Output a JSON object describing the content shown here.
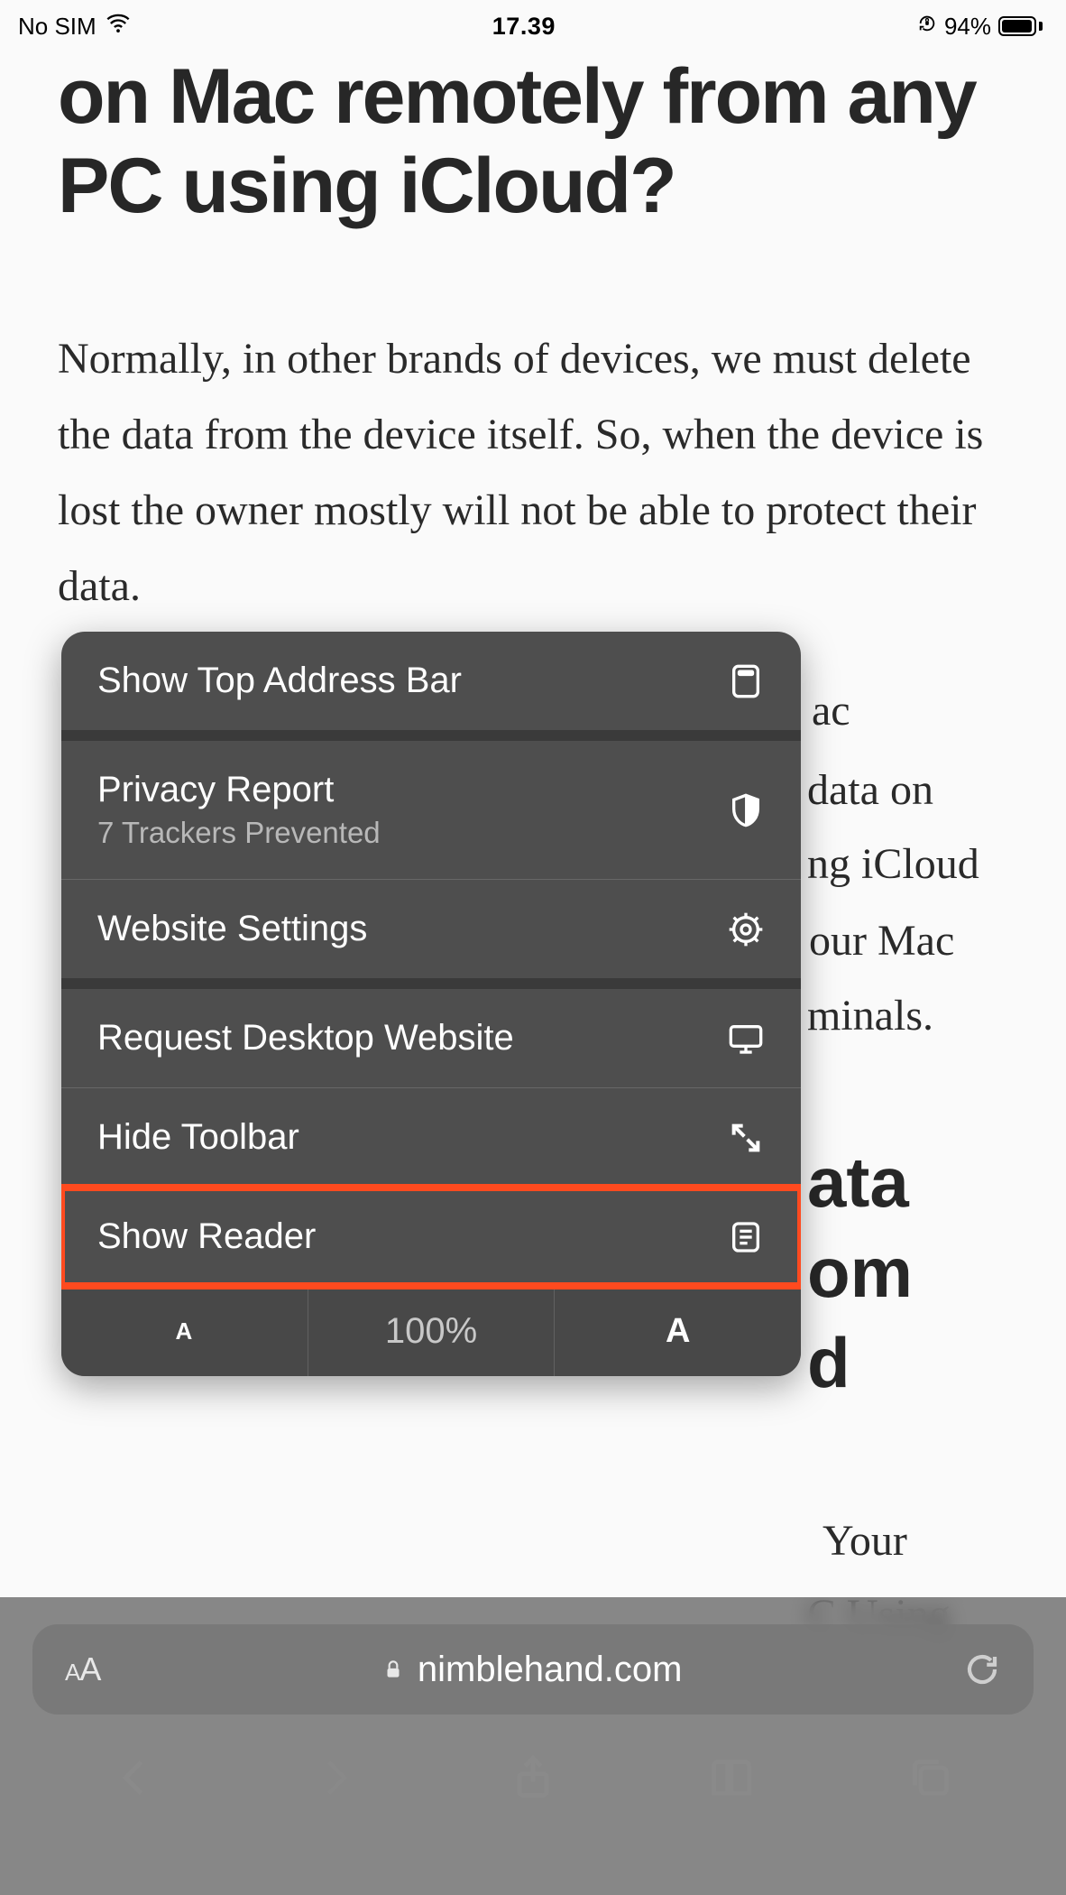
{
  "status": {
    "carrier": "No SIM",
    "time": "17.39",
    "battery_percent": "94%"
  },
  "page": {
    "title": "on Mac remotely from any PC using iCloud?",
    "paragraph1": "Normally, in other brands of devices, we must delete the data from the device itself. So, when the device is lost the owner mostly will not be able to protect their data.",
    "frag1": "ac",
    "frag2": "data on",
    "frag3": "ng iCloud",
    "frag4": "our Mac",
    "frag5": "minals.",
    "subhead_frag1": "ata",
    "subhead_frag2": "om",
    "subhead_frag3": "d",
    "tail_frag1": "Your",
    "tail_frag2": "C Using"
  },
  "menu": {
    "show_top_address_bar": "Show Top Address Bar",
    "privacy_report": "Privacy Report",
    "privacy_sub": "7 Trackers Prevented",
    "website_settings": "Website Settings",
    "request_desktop": "Request Desktop Website",
    "hide_toolbar": "Hide Toolbar",
    "show_reader": "Show Reader",
    "zoom_small": "A",
    "zoom_value": "100%",
    "zoom_big": "A"
  },
  "urlbar": {
    "aa_small": "A",
    "aa_big": "A",
    "domain": "nimblehand.com"
  }
}
